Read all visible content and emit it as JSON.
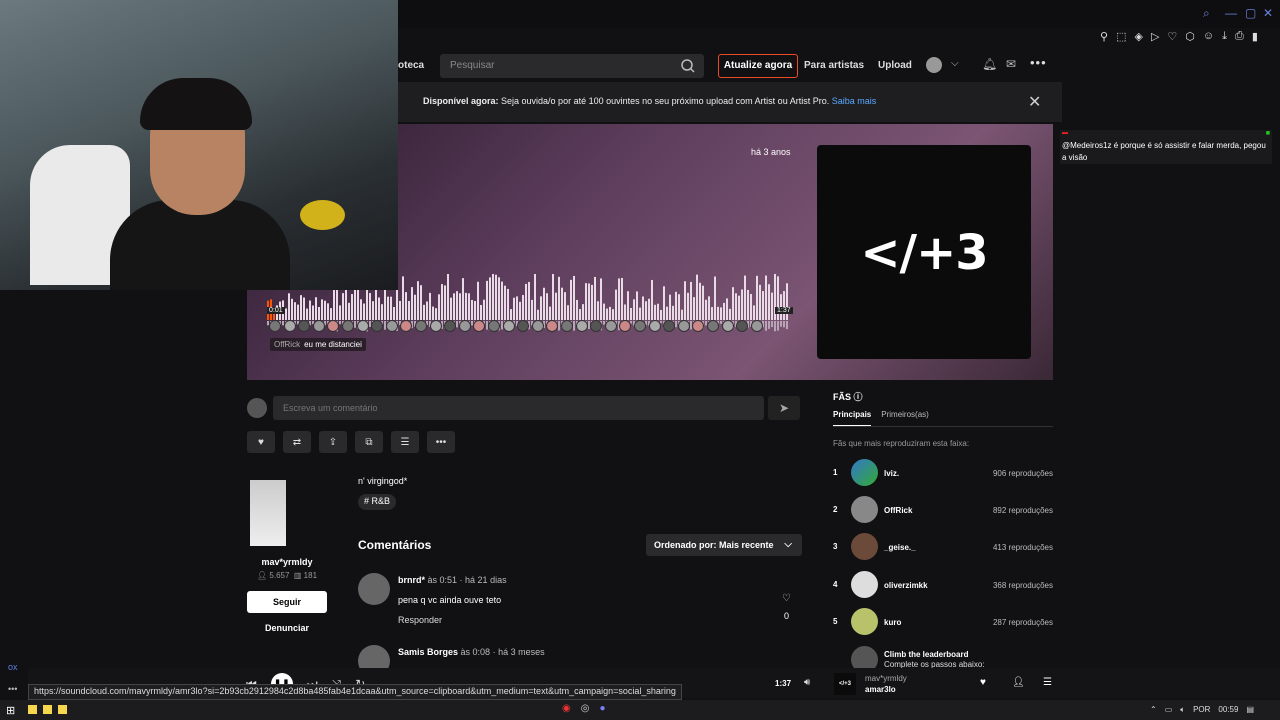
{
  "header": {
    "nav_library": "oteca",
    "search_placeholder": "Pesquisar",
    "upgrade": "Atualize agora",
    "for_artists": "Para artistas",
    "upload": "Upload"
  },
  "banner": {
    "bold": "Disponível agora:",
    "text": " Seja ouvida/o por até 100 ouvintes no seu próximo upload com Artist ou Artist Pro. ",
    "link": "Saiba mais"
  },
  "track": {
    "posted": "há 3 anos",
    "art_text": "</+3",
    "time_start": "0:01",
    "time_end": "1:37",
    "tooltip_user": "OffRick",
    "tooltip_text": "eu me distanciei"
  },
  "comment_input": {
    "placeholder": "Escreva um comentário"
  },
  "artist": {
    "name": "mav*yrmldy",
    "followers": "5.657",
    "tracks": "181",
    "follow": "Seguir",
    "report": "Denunciar"
  },
  "description": {
    "text": "n' virgingod*",
    "tag": "# R&B"
  },
  "comments": {
    "title": "Comentários",
    "sort": "Ordenado por: Mais recente",
    "items": [
      {
        "user": "brnrd*",
        "at": " às ",
        "time": "0:51",
        "ago": " · há 21 dias",
        "text": "pena q vc ainda ouve teto",
        "reply": "Responder",
        "likes": "0"
      },
      {
        "user": "Samis Borges",
        "at": " às ",
        "time": "0:08",
        "ago": " · há 3 meses"
      }
    ]
  },
  "fans": {
    "title": "FÃS",
    "tab_main": "Principais",
    "tab_first": "Primeiros(as)",
    "subtitle": "Fãs que mais reproduziram esta faixa:",
    "list": [
      {
        "rank": "1",
        "name": "lviz.",
        "plays": "906 reproduções"
      },
      {
        "rank": "2",
        "name": "OffRick",
        "plays": "892 reproduções"
      },
      {
        "rank": "3",
        "name": "_geise._",
        "plays": "413 reproduções"
      },
      {
        "rank": "4",
        "name": "oliverzimkk",
        "plays": "368 reproduções"
      },
      {
        "rank": "5",
        "name": "kuro",
        "plays": "287 reproduções"
      }
    ],
    "climb_title": "Climb the leaderboard",
    "climb_sub": "Complete os passos abaixo:"
  },
  "chat": {
    "message": "@Medeiros1z é porque é só assistir e falar merda, pegou a visão"
  },
  "player": {
    "time": "1:37",
    "artist": "mav*yrmldy",
    "track": "amar3lo",
    "art": "</+3",
    "url": "https://soundcloud.com/mavyrmldy/amr3lo?si=2b93cb2912984c2d8ba485fab4e1dcaa&utm_source=clipboard&utm_medium=text&utm_campaign=social_sharing"
  },
  "overlay": {
    "ox": "ox",
    "dots": "•••"
  },
  "taskbar": {
    "lang": "POR",
    "time": "00:59"
  }
}
